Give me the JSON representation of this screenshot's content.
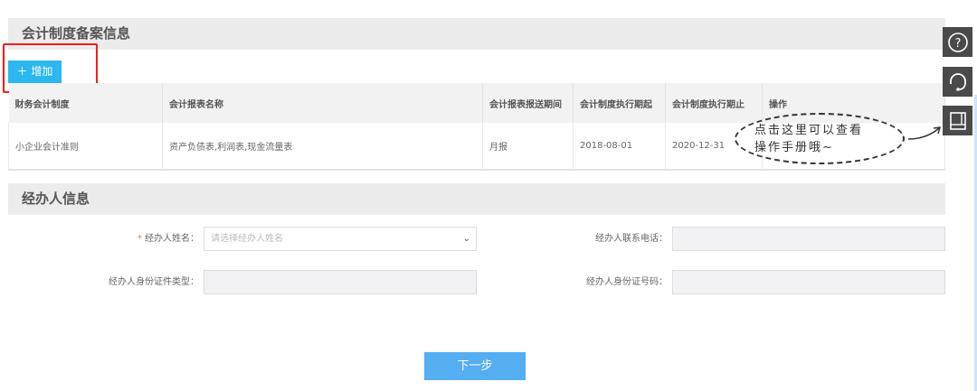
{
  "section1": {
    "title": "会计制度备案信息",
    "add_label": "＋ 增加"
  },
  "table": {
    "headers": [
      "财务会计制度",
      "会计报表名称",
      "会计报表报送期间",
      "会计制度执行期起",
      "会计制度执行期止",
      "操作"
    ],
    "rows": [
      [
        "小企业会计准则",
        "资产负债表,利润表,现金流量表",
        "月报",
        "2018-08-01",
        "2020-12-31",
        ""
      ]
    ]
  },
  "tooltip": {
    "line1": "点击这里可以查看",
    "line2": "操作手册哦~"
  },
  "section2": {
    "title": "经办人信息"
  },
  "form": {
    "required_mark": "*",
    "name_label": "经办人姓名：",
    "name_placeholder": "请选择经办人姓名",
    "phone_label": "经办人联系电话：",
    "idtype_label": "经办人身份证件类型：",
    "idno_label": "经办人身份证号码："
  },
  "next_label": "下一步",
  "side_icons": [
    "help-icon",
    "customer-service-icon",
    "manual-icon"
  ],
  "colors": {
    "accent": "#2cb7f0",
    "next_button": "#55adf2",
    "highlight_box": "#f21c1c"
  }
}
